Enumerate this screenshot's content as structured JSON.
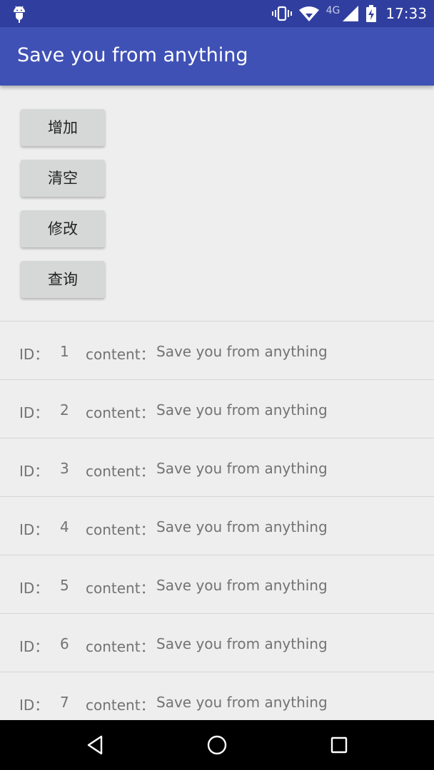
{
  "status_bar": {
    "time": "17:33",
    "network_type": "4G",
    "icons": [
      "android-debug-icon",
      "vibrate-icon",
      "wifi-icon",
      "signal-icon",
      "battery-charging-icon"
    ]
  },
  "app_bar": {
    "title": "Save you from anything",
    "color": "#3f51b5",
    "status_color": "#303f9f"
  },
  "buttons": [
    {
      "label": "增加"
    },
    {
      "label": "清空"
    },
    {
      "label": "修改"
    },
    {
      "label": "查询"
    }
  ],
  "list": {
    "id_label": "ID：",
    "content_label": "content：",
    "items": [
      {
        "id": "1",
        "content": "Save you from anything"
      },
      {
        "id": "2",
        "content": "Save you from anything"
      },
      {
        "id": "3",
        "content": "Save you from anything"
      },
      {
        "id": "4",
        "content": "Save you from anything"
      },
      {
        "id": "5",
        "content": "Save you from anything"
      },
      {
        "id": "6",
        "content": "Save you from anything"
      },
      {
        "id": "7",
        "content": "Save you from anything"
      }
    ]
  },
  "nav_bar": {
    "icons": [
      "back-icon",
      "home-icon",
      "recents-icon"
    ]
  }
}
